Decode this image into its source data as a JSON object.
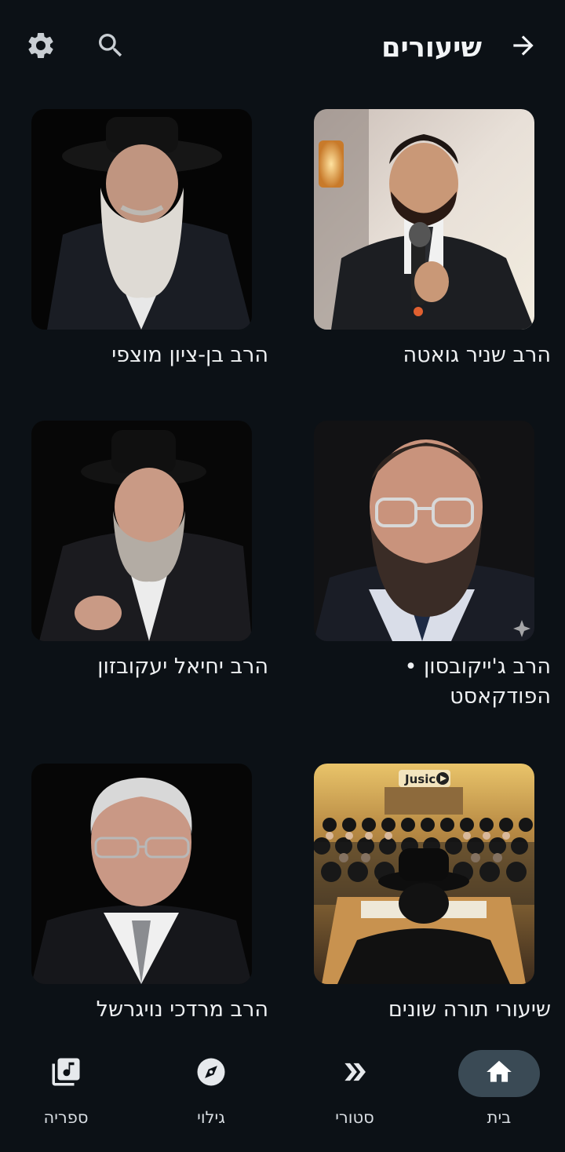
{
  "header": {
    "title": "שיעורים",
    "back_icon": "arrow-right-icon",
    "search_icon": "search-icon",
    "settings_icon": "gear-icon"
  },
  "cards": [
    {
      "title": "הרב שניר גואטה",
      "image": "rabbi-with-microphone-photo"
    },
    {
      "title": "הרב בן-ציון מוצפי",
      "image": "rabbi-white-beard-black-hat-photo"
    },
    {
      "title": "הרב ג'ייקובסון • הפודקאסט",
      "image": "rabbi-glasses-beard-photo"
    },
    {
      "title": "הרב יחיאל יעקובזון",
      "image": "rabbi-black-hat-gesturing-photo"
    },
    {
      "title": "שיעורי תורה שונים",
      "image": "lecture-hall-audience-photo",
      "logo_text": "Jusic"
    },
    {
      "title": "הרב מרדכי נויגרשל",
      "image": "rabbi-glasses-suit-photo"
    }
  ],
  "bottom_nav": {
    "items": [
      {
        "label": "בית",
        "icon": "home-icon",
        "active": true
      },
      {
        "label": "סטורי",
        "icon": "double-chevron-icon",
        "active": false
      },
      {
        "label": "גילוי",
        "icon": "compass-icon",
        "active": false
      },
      {
        "label": "ספריה",
        "icon": "library-music-icon",
        "active": false
      }
    ]
  },
  "colors": {
    "background": "#0c1116",
    "active_pill": "#3a4a55",
    "text": "#eef0f2"
  }
}
